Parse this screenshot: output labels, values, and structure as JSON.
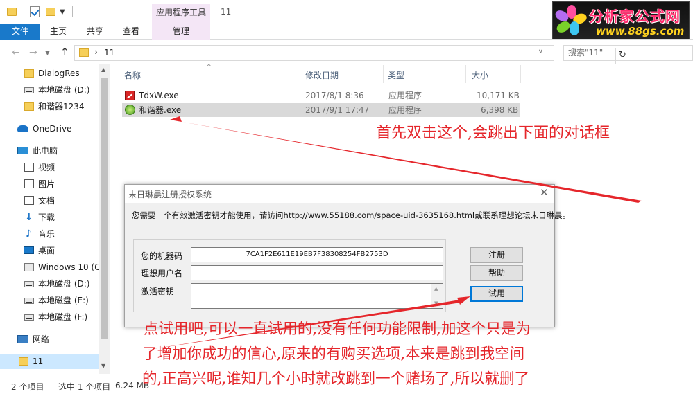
{
  "window": {
    "title": "11",
    "ribbon_context_header": "应用程序工具",
    "tabs": [
      "文件",
      "主页",
      "共享",
      "查看",
      "管理"
    ]
  },
  "logo": {
    "name": "分析家公式网",
    "url": "www.88gs.com"
  },
  "address": {
    "path": "11",
    "search_placeholder": "搜索\"11\""
  },
  "nav_pane": {
    "items": [
      "DialogRes",
      "本地磁盘 (D:)",
      "和谐器1234",
      "OneDrive",
      "此电脑",
      "视频",
      "图片",
      "文档",
      "下载",
      "音乐",
      "桌面",
      "Windows 10 (C",
      "本地磁盘 (D:)",
      "本地磁盘 (E:)",
      "本地磁盘 (F:)",
      "网络",
      "11"
    ]
  },
  "file_list": {
    "columns": [
      "名称",
      "修改日期",
      "类型",
      "大小"
    ],
    "rows": [
      {
        "name": "TdxW.exe",
        "date": "2017/8/1 8:36",
        "type": "应用程序",
        "size": "10,171 KB"
      },
      {
        "name": "和谐器.exe",
        "date": "2017/9/1 17:47",
        "type": "应用程序",
        "size": "6,398 KB"
      }
    ]
  },
  "status": {
    "count": "2 个项目",
    "selected": "选中 1 个项目",
    "size": "6.24 MB"
  },
  "dialog": {
    "title": "末日琳晨注册授权系统",
    "message": "您需要一个有效激活密钥才能使用，请访问http://www.55188.com/space-uid-3635168.html或联系理想论坛末日琳晨。",
    "machine_code_label": "您的机器码",
    "machine_code": "7CA1F2E611E19EB7F38308254FB2753D",
    "username_label": "理想用户名",
    "key_label": "激活密钥",
    "register_button": "注册",
    "help_button": "帮助",
    "trial_button": "试用"
  },
  "annotations": {
    "top": "首先双击这个,会跳出下面的对话框",
    "bottom_line1": "点试用吧,可以一直试用的,没有任何功能限制,加这个只是为",
    "bottom_line2": "了增加你成功的信心,原来的有购买选项,本来是跳到我空间",
    "bottom_line3": "的,正高兴呢,谁知几个小时就改跳到一个赌场了,所以就删了"
  },
  "colors": {
    "accent": "#1979ca",
    "annotation": "#e5262b",
    "selection": "#d9d9d9"
  }
}
